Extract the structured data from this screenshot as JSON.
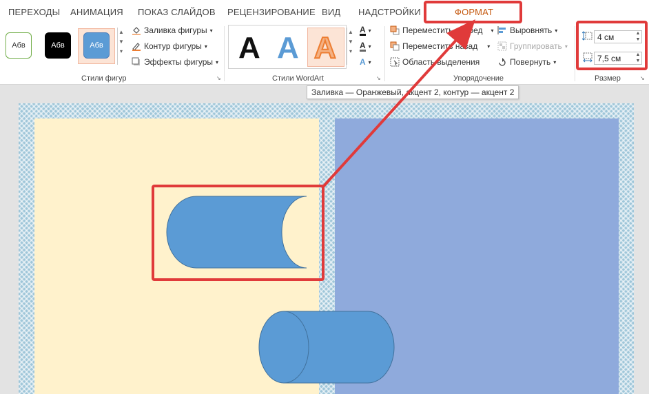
{
  "tabs": [
    {
      "label": "ПЕРЕХОДЫ"
    },
    {
      "label": "АНИМАЦИЯ"
    },
    {
      "label": "ПОКАЗ СЛАЙДОВ"
    },
    {
      "label": "РЕЦЕНЗИРОВАНИЕ"
    },
    {
      "label": "ВИД"
    },
    {
      "label": "НАДСТРОЙКИ"
    },
    {
      "label": "ФОРМАТ"
    }
  ],
  "shape_styles": {
    "group_label": "Стили фигур",
    "swatches": [
      {
        "label": "Абв",
        "fill": "#ffffff",
        "border": "#70ad47",
        "text": "#333333"
      },
      {
        "label": "Абв",
        "fill": "#000000",
        "border": "#000000",
        "text": "#ffffff"
      },
      {
        "label": "Абв",
        "fill": "#5b9bd5",
        "border": "#4a7ebb",
        "text": "#ffffff"
      }
    ],
    "fill_label": "Заливка фигуры",
    "outline_label": "Контур фигуры",
    "effects_label": "Эффекты фигуры"
  },
  "wordart": {
    "group_label": "Стили WordArt",
    "letters": [
      {
        "char": "A",
        "color": "#111111"
      },
      {
        "char": "A",
        "color": "#5b9bd5"
      },
      {
        "char": "A",
        "color": "#f4b183"
      }
    ]
  },
  "arrange": {
    "group_label": "Упорядочение",
    "bring_forward": "Переместить вперед",
    "send_backward": "Переместить назад",
    "selection_pane": "Область выделения",
    "align": "Выровнять",
    "group": "Группировать",
    "rotate": "Повернуть"
  },
  "size": {
    "group_label": "Размер",
    "height": "4 см",
    "width": "7,5 см"
  },
  "tooltip": "Заливка — Оранжевый, акцент 2, контур — акцент 2",
  "colors": {
    "accent_red": "#e03a3a",
    "format_tab": "#c55a11",
    "shape_blue": "#5b9bd5",
    "shape_outline": "#41719c"
  }
}
